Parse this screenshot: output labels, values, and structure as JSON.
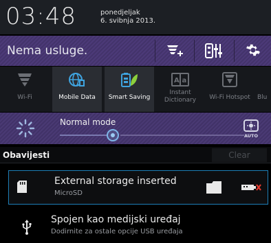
{
  "header": {
    "time": "03:48",
    "weekday": "ponedjeljak",
    "date": "6. svibnja 2013."
  },
  "statusbar": {
    "carrier": "Nema usluge."
  },
  "toggles": [
    {
      "label": "Wi-Fi",
      "icon": "wifi-icon",
      "active": false
    },
    {
      "label": "Mobile Data",
      "icon": "globe-icon",
      "active": true
    },
    {
      "label": "Smart Saving",
      "icon": "battery-leaf-icon",
      "active": true
    },
    {
      "label": "Instant Dictionary",
      "label1": "Instant",
      "label2": "Dictionary",
      "icon": "dictionary-icon",
      "active": false
    },
    {
      "label": "Wi-Fi Hotspot",
      "icon": "hotspot-icon",
      "active": false
    },
    {
      "label": "Blu",
      "icon": "bluetooth-icon",
      "active": false
    }
  ],
  "brightness": {
    "mode": "Normal mode",
    "level": 0.24,
    "auto_label": "AUTO"
  },
  "notifications": {
    "title": "Obavijesti",
    "clear_label": "Clear",
    "items": [
      {
        "title": "External storage inserted",
        "subtitle": "MicroSD"
      },
      {
        "title": "Spojen kao medijski uređaj",
        "subtitle": "Dodirnite za ostale opcije USB uređaja"
      }
    ]
  },
  "colors": {
    "accent_purple": "#4c3a78",
    "accent_blue": "#1e7fb8",
    "active_icon": "#3fa4e0",
    "active_leaf": "#8ccf3c"
  }
}
